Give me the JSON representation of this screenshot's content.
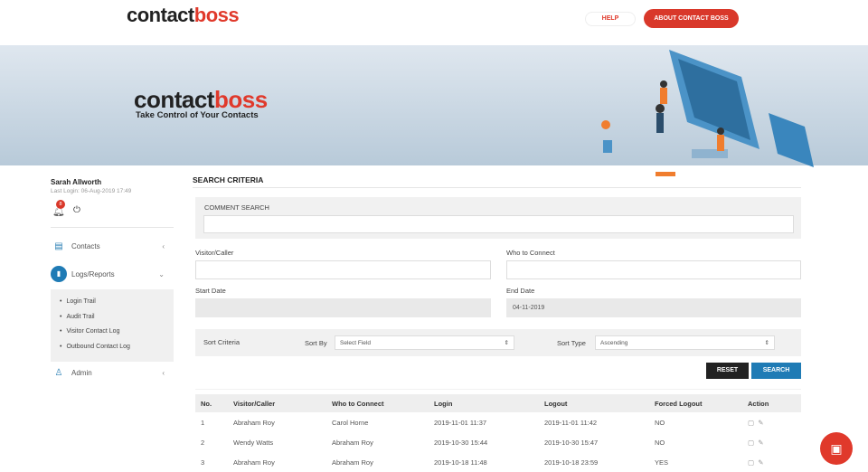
{
  "header": {
    "logo_left": "contact",
    "logo_right": "boss",
    "help": "HELP",
    "about": "ABOUT CONTACT BOSS"
  },
  "banner": {
    "logo_left": "contact",
    "logo_right": "boss",
    "tagline": "Take Control of Your Contacts"
  },
  "user": {
    "name": "Sarah Allworth",
    "last_login": "Last Login: 06-Aug-2019 17:49",
    "notifications": "8"
  },
  "sidebar": {
    "items": [
      {
        "label": "Contacts"
      },
      {
        "label": "Logs/Reports"
      },
      {
        "label": "Admin"
      }
    ],
    "sub_items": [
      "Login Trail",
      "Audit Trail",
      "Visitor Contact Log",
      "Outbound Contact Log"
    ]
  },
  "search": {
    "title": "SEARCH CRITERIA",
    "comment_label": "COMMENT SEARCH",
    "comment_value": "",
    "visitor_label": "Visitor/Caller",
    "who_label": "Who to Connect",
    "start_label": "Start Date",
    "end_label": "End Date",
    "end_value": "04-11-2019",
    "sort_criteria": "Sort Criteria",
    "sort_by_label": "Sort By",
    "sort_by_value": "Select Field",
    "sort_type_label": "Sort Type",
    "sort_type_value": "Ascending",
    "reset": "RESET",
    "search": "SEARCH"
  },
  "table": {
    "headers": [
      "No.",
      "Visitor/Caller",
      "Who to Connect",
      "Login",
      "Logout",
      "Forced Logout",
      "Action"
    ],
    "rows": [
      [
        "1",
        "Abraham Roy",
        "Carol Horne",
        "2019-11-01 11:37",
        "2019-11-01 11:42",
        "NO"
      ],
      [
        "2",
        "Wendy Watts",
        "Abraham Roy",
        "2019-10-30 15:44",
        "2019-10-30 15:47",
        "NO"
      ],
      [
        "3",
        "Abraham Roy",
        "Abraham Roy",
        "2019-10-18 11:48",
        "2019-10-18 23:59",
        "YES"
      ]
    ]
  }
}
